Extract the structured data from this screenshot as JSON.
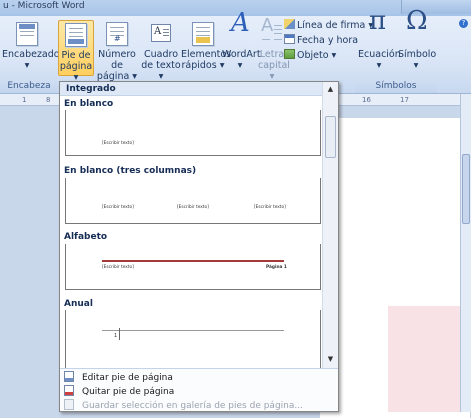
{
  "window": {
    "title": "u - Microsoft Word"
  },
  "ribbon": {
    "encabezado": {
      "line1": "Encabezado",
      "line2": "▾"
    },
    "pie_pagina": {
      "line1": "Pie de",
      "line2": "página ▾"
    },
    "numero_pagina": {
      "line1": "Número de",
      "line2": "página ▾"
    },
    "cuadro_texto": {
      "line1": "Cuadro",
      "line2": "de texto ▾"
    },
    "elementos_rapidos": {
      "line1": "Elementos",
      "line2": "rápidos ▾"
    },
    "wordart": {
      "line1": "WordArt",
      "line2": "▾"
    },
    "letra_capital": {
      "line1": "Letra",
      "line2": "capital ▾"
    },
    "linea_firma": "Línea de firma ▾",
    "fecha_hora": "Fecha y hora",
    "objeto": "Objeto ▾",
    "ecuacion": {
      "line1": "Ecuación",
      "line2": "▾"
    },
    "simbolo": {
      "line1": "Símbolo",
      "line2": "▾"
    },
    "group_encabezado": "Encabeza",
    "group_simbolos": "Símbolos",
    "help": "?"
  },
  "ruler": {
    "ticks": [
      "1",
      "8",
      "16",
      "17"
    ]
  },
  "dropdown": {
    "header": "Integrado",
    "categories": [
      {
        "name": "En blanco",
        "placeholders": [
          "[Escribir texto]"
        ]
      },
      {
        "name": "En blanco (tres columnas)",
        "placeholders": [
          "[Escribir texto]",
          "[Escribir texto]",
          "[Escribir texto]"
        ]
      },
      {
        "name": "Alfabeto",
        "placeholders": [
          "[Escribir texto]",
          "Página 1"
        ]
      },
      {
        "name": "Anual",
        "placeholders": [
          "1"
        ]
      }
    ],
    "scroll_up": "▲",
    "scroll_down": "▼",
    "footer": [
      {
        "label": "Editar pie de página",
        "enabled": true
      },
      {
        "label": "Quitar pie de página",
        "enabled": true
      },
      {
        "label": "Guardar selección en galería de pies de página...",
        "enabled": false
      }
    ]
  },
  "colors": {
    "accent_active": "#ffcf5e",
    "ribbon_text": "#1f3a63",
    "alfabeto_line": "#a33a3a"
  },
  "icons": {
    "encabezado": "header-doc-icon",
    "pie_pagina": "footer-doc-icon",
    "numero_pagina": "page-number-icon",
    "cuadro_texto": "text-box-icon",
    "elementos_rapidos": "quick-parts-icon",
    "wordart": "wordart-icon",
    "letra_capital": "drop-cap-icon",
    "ecuacion": "pi-icon",
    "simbolo": "omega-icon"
  }
}
